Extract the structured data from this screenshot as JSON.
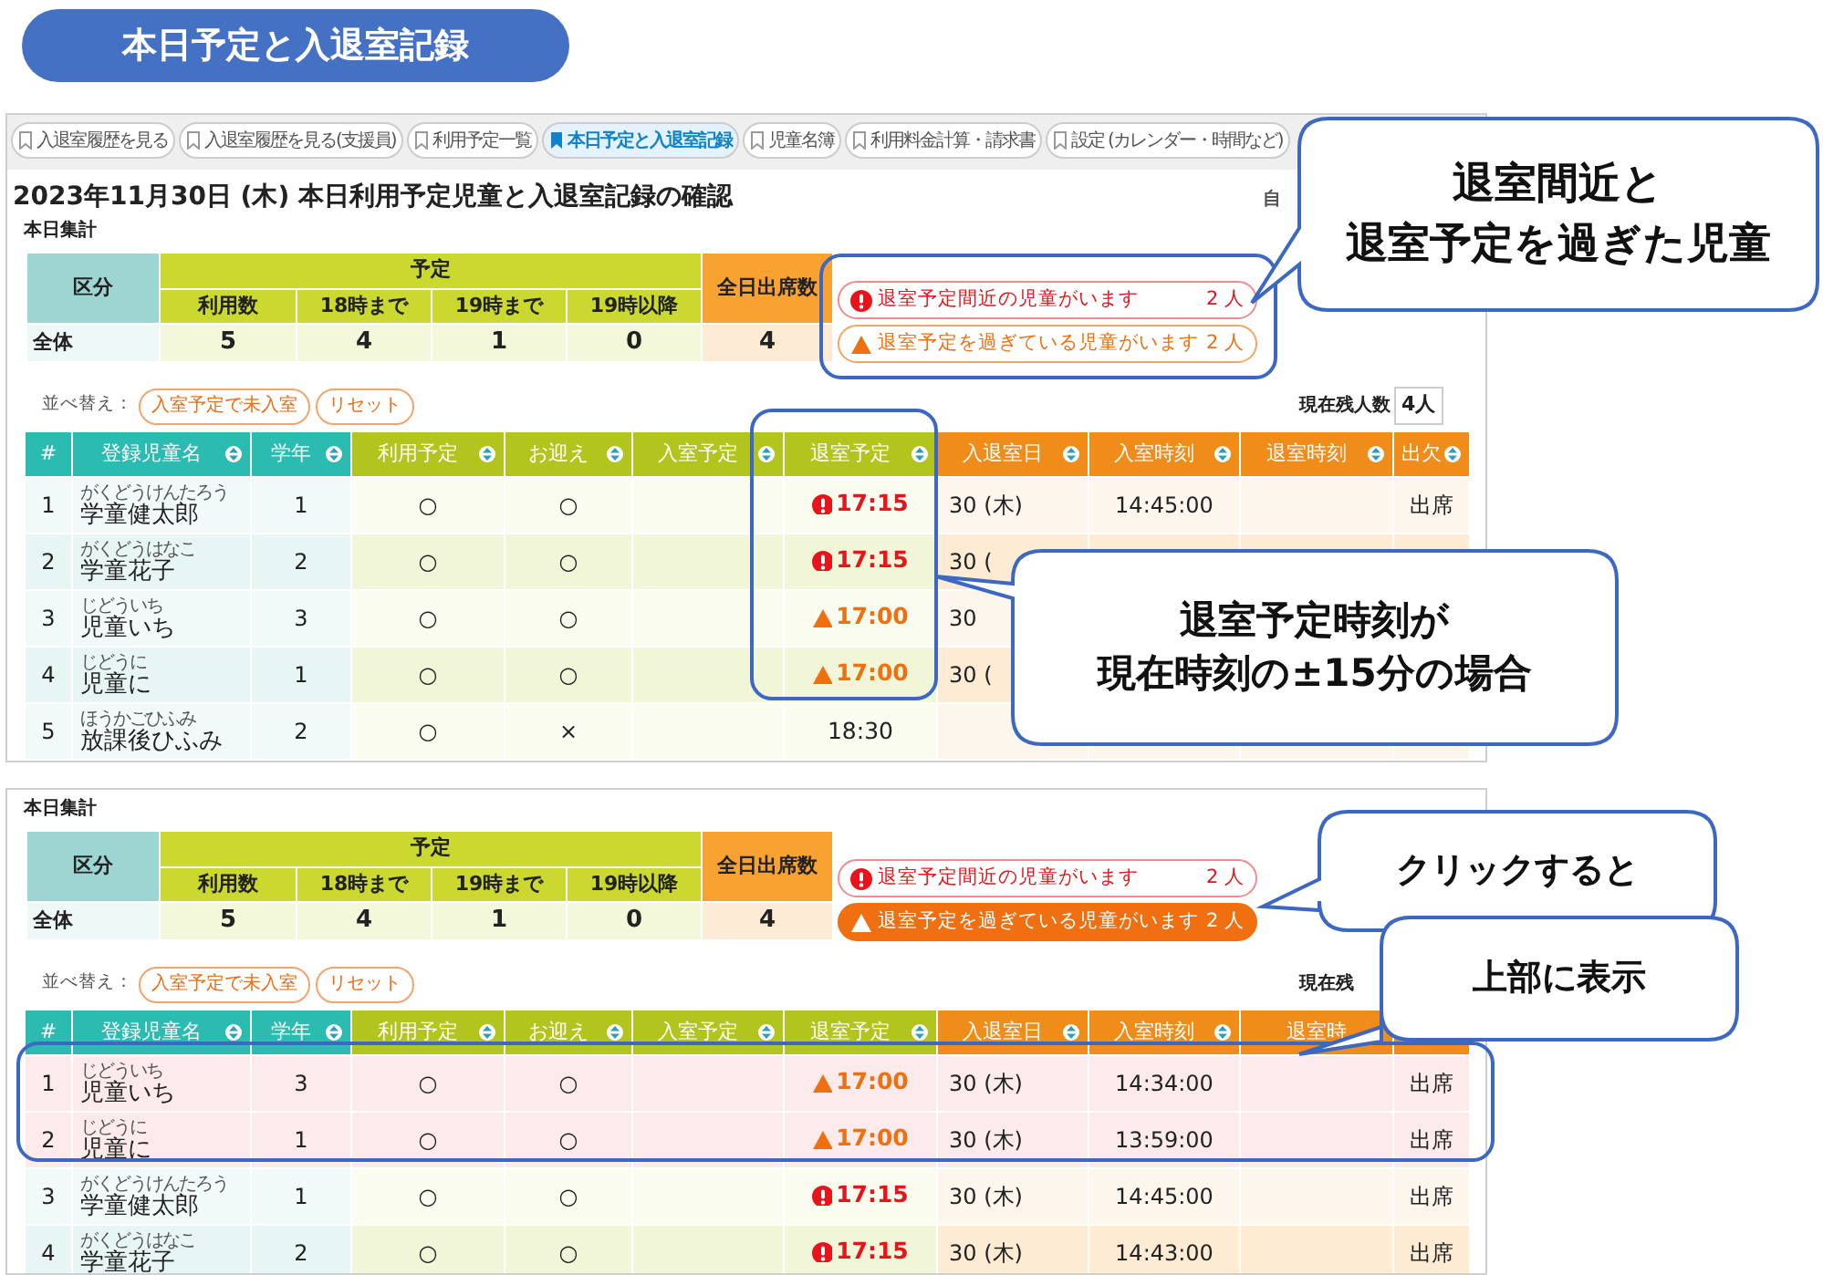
{
  "title": "本日予定と入退室記録",
  "panels": [
    {
      "tabs": [
        {
          "label": "入退室履歴を見る",
          "selected": false
        },
        {
          "label": "入退室履歴を見る(支援員)",
          "selected": false
        },
        {
          "label": "利用予定一覧",
          "selected": false
        },
        {
          "label": "本日予定と入退室記録",
          "selected": true
        },
        {
          "label": "児童名簿",
          "selected": false
        },
        {
          "label": "利用料金計算・請求書",
          "selected": false
        },
        {
          "label": "設定 (カレンダー・時間など)",
          "selected": false
        }
      ],
      "heading": "2023年11月30日 (木) 本日利用予定児童と入退室記録の確認",
      "heading_right": "自",
      "summary": {
        "label": "本日集計",
        "row_header": "区分",
        "plan_group": "予定",
        "plan_columns": [
          "利用数",
          "18時まで",
          "19時まで",
          "19時以降"
        ],
        "attendance_header": "全日出席数",
        "rows": [
          {
            "label": "全体",
            "values": [
              "5",
              "4",
              "1",
              "0"
            ],
            "attendance": "4"
          }
        ]
      },
      "alerts": [
        {
          "kind": "near",
          "text": "退室予定間近の児童がいます",
          "count": "2 人",
          "selected": false
        },
        {
          "kind": "past",
          "text": "退室予定を過ぎている児童がいます",
          "count": "2 人",
          "selected": false
        }
      ],
      "sort": {
        "label": "並べ替え：",
        "buttons": [
          "入室予定で未入室",
          "リセット"
        ]
      },
      "remaining": {
        "label": "現在残人数",
        "value": "4人"
      },
      "table": {
        "columns": [
          {
            "label": "#",
            "kind": "student",
            "sortable": false
          },
          {
            "label": "登録児童名",
            "kind": "student",
            "sortable": true
          },
          {
            "label": "学年",
            "kind": "student",
            "sortable": true
          },
          {
            "label": "利用予定",
            "kind": "plan",
            "sortable": true
          },
          {
            "label": "お迎え",
            "kind": "plan",
            "sortable": true
          },
          {
            "label": "入室予定",
            "kind": "plan",
            "sortable": true
          },
          {
            "label": "退室予定",
            "kind": "plan",
            "sortable": true
          },
          {
            "label": "入退室日",
            "kind": "record",
            "sortable": true
          },
          {
            "label": "入室時刻",
            "kind": "record",
            "sortable": true
          },
          {
            "label": "退室時刻",
            "kind": "record",
            "sortable": true
          },
          {
            "label": "出欠",
            "kind": "record",
            "sortable": true
          }
        ],
        "rows": [
          {
            "highlighted": false,
            "no": "1",
            "reading": "がくどうけんたろう",
            "name": "学童健太郎",
            "grade": "1",
            "use": "○",
            "pickup": "○",
            "exit": {
              "time": "17:15",
              "kind": "near"
            },
            "date": "30 (木)",
            "in": "14:45:00",
            "status": "出席"
          },
          {
            "highlighted": false,
            "no": "2",
            "reading": "がくどうはなこ",
            "name": "学童花子",
            "grade": "2",
            "use": "○",
            "pickup": "○",
            "exit": {
              "time": "17:15",
              "kind": "near"
            },
            "date": "30 ("
          },
          {
            "highlighted": false,
            "no": "3",
            "reading": "じどういち",
            "name": "児童いち",
            "grade": "3",
            "use": "○",
            "pickup": "○",
            "exit": {
              "time": "17:00",
              "kind": "past"
            },
            "date": "30"
          },
          {
            "highlighted": false,
            "no": "4",
            "reading": "じどうに",
            "name": "児童に",
            "grade": "1",
            "use": "○",
            "pickup": "○",
            "exit": {
              "time": "17:00",
              "kind": "past"
            },
            "date": "30 ("
          },
          {
            "highlighted": false,
            "no": "5",
            "reading": "ほうかごひふみ",
            "name": "放課後ひふみ",
            "grade": "2",
            "use": "○",
            "pickup": "×",
            "exit": {
              "time": "18:30",
              "kind": "plain"
            }
          }
        ]
      }
    },
    {
      "summary": {
        "label": "本日集計",
        "row_header": "区分",
        "plan_group": "予定",
        "plan_columns": [
          "利用数",
          "18時まで",
          "19時まで",
          "19時以降"
        ],
        "attendance_header": "全日出席数",
        "rows": [
          {
            "label": "全体",
            "values": [
              "5",
              "4",
              "1",
              "0"
            ],
            "attendance": "4"
          }
        ]
      },
      "alerts": [
        {
          "kind": "near",
          "text": "退室予定間近の児童がいます",
          "count": "2 人",
          "selected": false
        },
        {
          "kind": "past",
          "text": "退室予定を過ぎている児童がいます",
          "count": "2 人",
          "selected": true
        }
      ],
      "sort": {
        "label": "並べ替え：",
        "buttons": [
          "入室予定で未入室",
          "リセット"
        ]
      },
      "remaining": {
        "label": "現在残"
      },
      "table": {
        "columns": [
          {
            "label": "#",
            "kind": "student",
            "sortable": false
          },
          {
            "label": "登録児童名",
            "kind": "student",
            "sortable": true
          },
          {
            "label": "学年",
            "kind": "student",
            "sortable": true
          },
          {
            "label": "利用予定",
            "kind": "plan",
            "sortable": true
          },
          {
            "label": "お迎え",
            "kind": "plan",
            "sortable": true
          },
          {
            "label": "入室予定",
            "kind": "plan",
            "sortable": true
          },
          {
            "label": "退室予定",
            "kind": "plan",
            "sortable": true
          },
          {
            "label": "入退室日",
            "kind": "record",
            "sortable": true
          },
          {
            "label": "入室時刻",
            "kind": "record",
            "sortable": true
          },
          {
            "label": "退室時",
            "kind": "record"
          },
          {
            "kind": "record"
          }
        ],
        "rows": [
          {
            "highlighted": true,
            "no": "1",
            "reading": "じどういち",
            "name": "児童いち",
            "grade": "3",
            "use": "○",
            "pickup": "○",
            "exit": {
              "time": "17:00",
              "kind": "past"
            },
            "date": "30 (木)",
            "in": "14:34:00",
            "status": "出席"
          },
          {
            "highlighted": true,
            "no": "2",
            "reading": "じどうに",
            "name": "児童に",
            "grade": "1",
            "use": "○",
            "pickup": "○",
            "exit": {
              "time": "17:00",
              "kind": "past"
            },
            "date": "30 (木)",
            "in": "13:59:00",
            "status": "出席"
          },
          {
            "highlighted": false,
            "no": "3",
            "reading": "がくどうけんたろう",
            "name": "学童健太郎",
            "grade": "1",
            "use": "○",
            "pickup": "○",
            "exit": {
              "time": "17:15",
              "kind": "near"
            },
            "date": "30 (木)",
            "in": "14:45:00",
            "status": "出席"
          },
          {
            "highlighted": false,
            "no": "4",
            "reading": "がくどうはなこ",
            "name": "学童花子",
            "grade": "2",
            "use": "○",
            "pickup": "○",
            "exit": {
              "time": "17:15",
              "kind": "near"
            },
            "date": "30 (木)",
            "in": "14:43:00",
            "status": "出席"
          }
        ]
      }
    }
  ],
  "callouts": [
    {
      "lines": [
        "退室間近と",
        "退室予定を過ぎた児童"
      ]
    },
    {
      "lines": [
        "退室予定時刻が",
        "現在時刻の±15分の場合"
      ]
    },
    {
      "lines": [
        "クリックすると"
      ]
    },
    {
      "lines": [
        "上部に表示"
      ]
    }
  ]
}
